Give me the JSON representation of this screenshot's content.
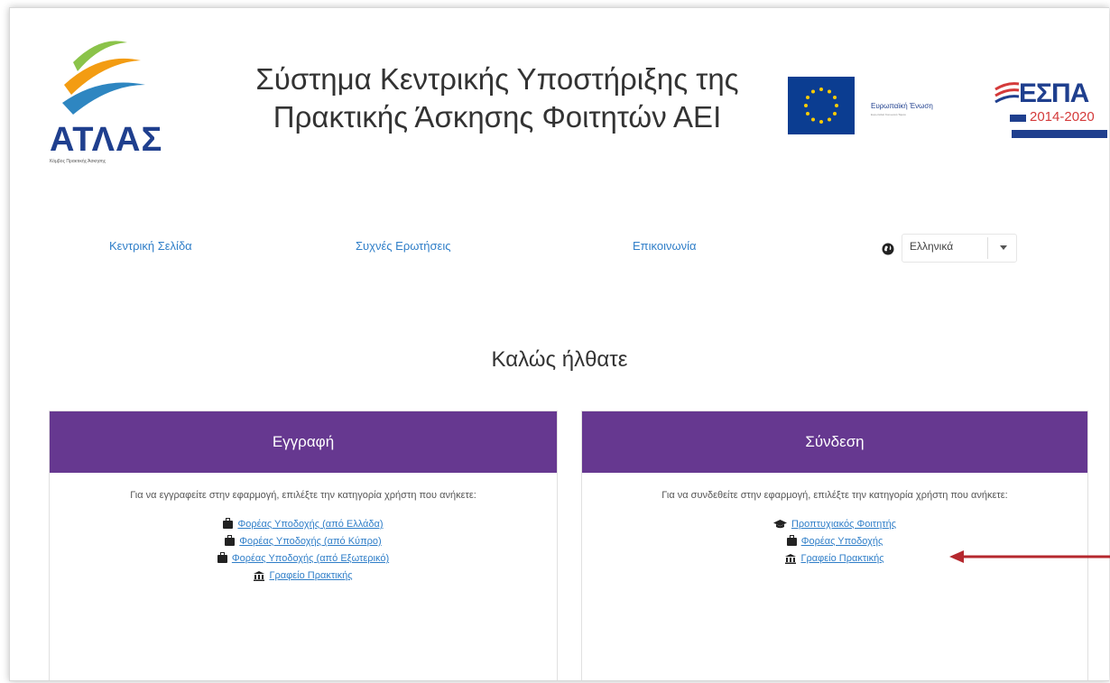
{
  "header": {
    "logo": {
      "text": "ΑΤΛΑΣ",
      "tagline": "Κόμβος Πρακτικής Άσκησης"
    },
    "title_line1": "Σύστημα Κεντρικής Υποστήριξης της",
    "title_line2": "Πρακτικής Άσκησης Φοιτητών ΑΕΙ",
    "eu": {
      "label": "Ευρωπαϊκή Ένωση",
      "sub": "Ευρωπαϊκό Κοινωνικό Ταμείο"
    },
    "espa": {
      "title": "ΕΣΠΑ",
      "years": "2014-2020"
    }
  },
  "nav": {
    "home": "Κεντρική Σελίδα",
    "faq": "Συχνές Ερωτήσεις",
    "contact": "Επικοινωνία",
    "language": {
      "selected": "Ελληνικά"
    }
  },
  "welcome": "Καλώς ήλθατε",
  "register": {
    "title": "Εγγραφή",
    "description": "Για να εγγραφείτε στην εφαρμογή, επιλέξτε την κατηγορία χρήστη που ανήκετε:",
    "links": [
      {
        "label": "Φορέας Υποδοχής (από Ελλάδα)",
        "icon": "briefcase-icon"
      },
      {
        "label": "Φορέας Υποδοχής (από Κύπρο)",
        "icon": "briefcase-icon"
      },
      {
        "label": "Φορέας Υποδοχής (από Εξωτερικό)",
        "icon": "briefcase-icon"
      },
      {
        "label": "Γραφείο Πρακτικής",
        "icon": "bank-icon"
      }
    ]
  },
  "login": {
    "title": "Σύνδεση",
    "description": "Για να συνδεθείτε στην εφαρμογή, επιλέξτε την κατηγορία χρήστη που ανήκετε:",
    "links": [
      {
        "label": "Προπτυχιακός Φοιτητής",
        "icon": "graduation-cap-icon"
      },
      {
        "label": "Φορέας Υποδοχής",
        "icon": "briefcase-icon"
      },
      {
        "label": "Γραφείο Πρακτικής",
        "icon": "bank-icon"
      }
    ]
  },
  "colors": {
    "primary": "#663890",
    "link": "#2f7ec8",
    "arrow": "#b5282e"
  }
}
